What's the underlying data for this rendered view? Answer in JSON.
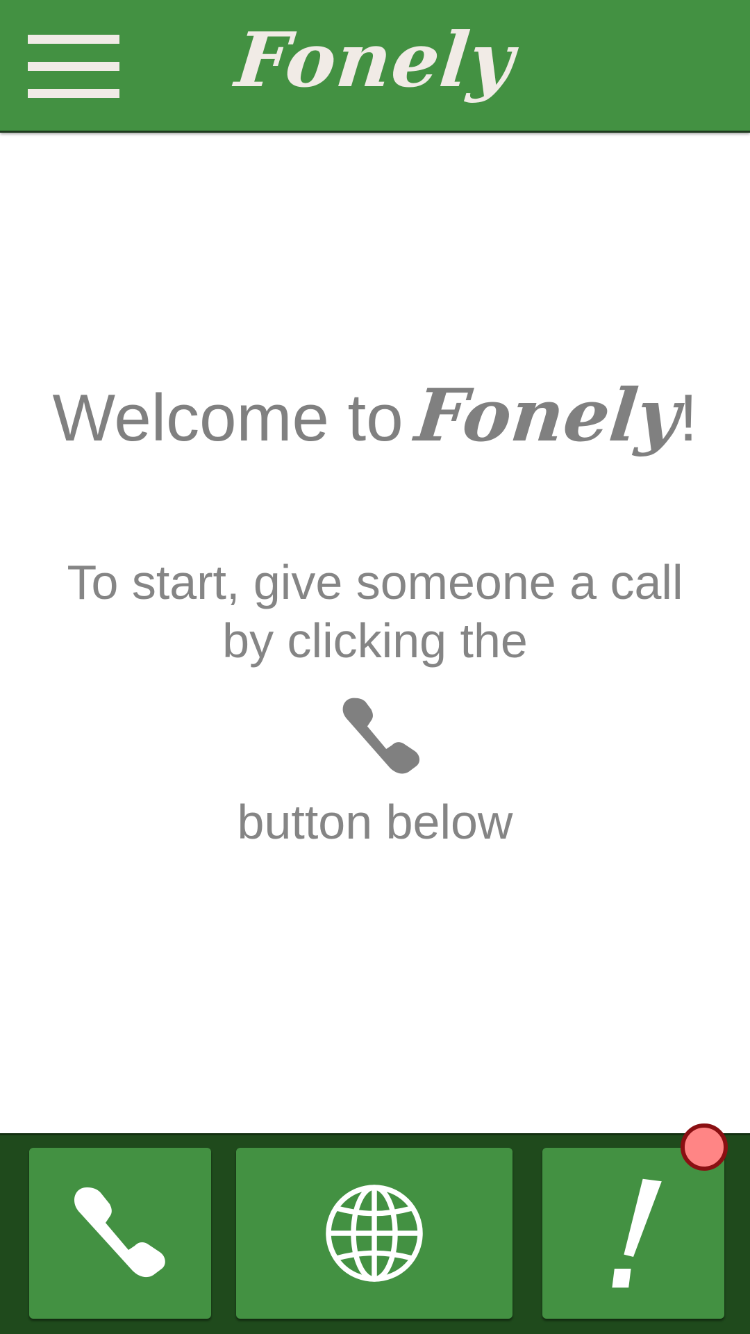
{
  "header": {
    "brand": "Fonely",
    "menu_icon": "hamburger-menu-icon"
  },
  "main": {
    "welcome_prefix": "Welcome to",
    "welcome_brand": "Fonely",
    "welcome_suffix": "!",
    "instruction_line1": "To start, give someone a call",
    "instruction_line2": "by clicking the",
    "instruction_icon": "phone-icon",
    "instruction_line3": "button below"
  },
  "bottom_nav": {
    "buttons": [
      {
        "name": "call",
        "icon": "phone-icon"
      },
      {
        "name": "globe",
        "icon": "globe-icon"
      },
      {
        "name": "alerts",
        "icon": "exclamation-icon",
        "has_notification": true
      }
    ]
  },
  "colors": {
    "header_green": "#439142",
    "nav_dark_green": "#1f4a1c",
    "text_gray": "#808080",
    "cream": "#f1ebe6",
    "notification_red": "#ff8585",
    "notification_border": "#8a0f12"
  }
}
